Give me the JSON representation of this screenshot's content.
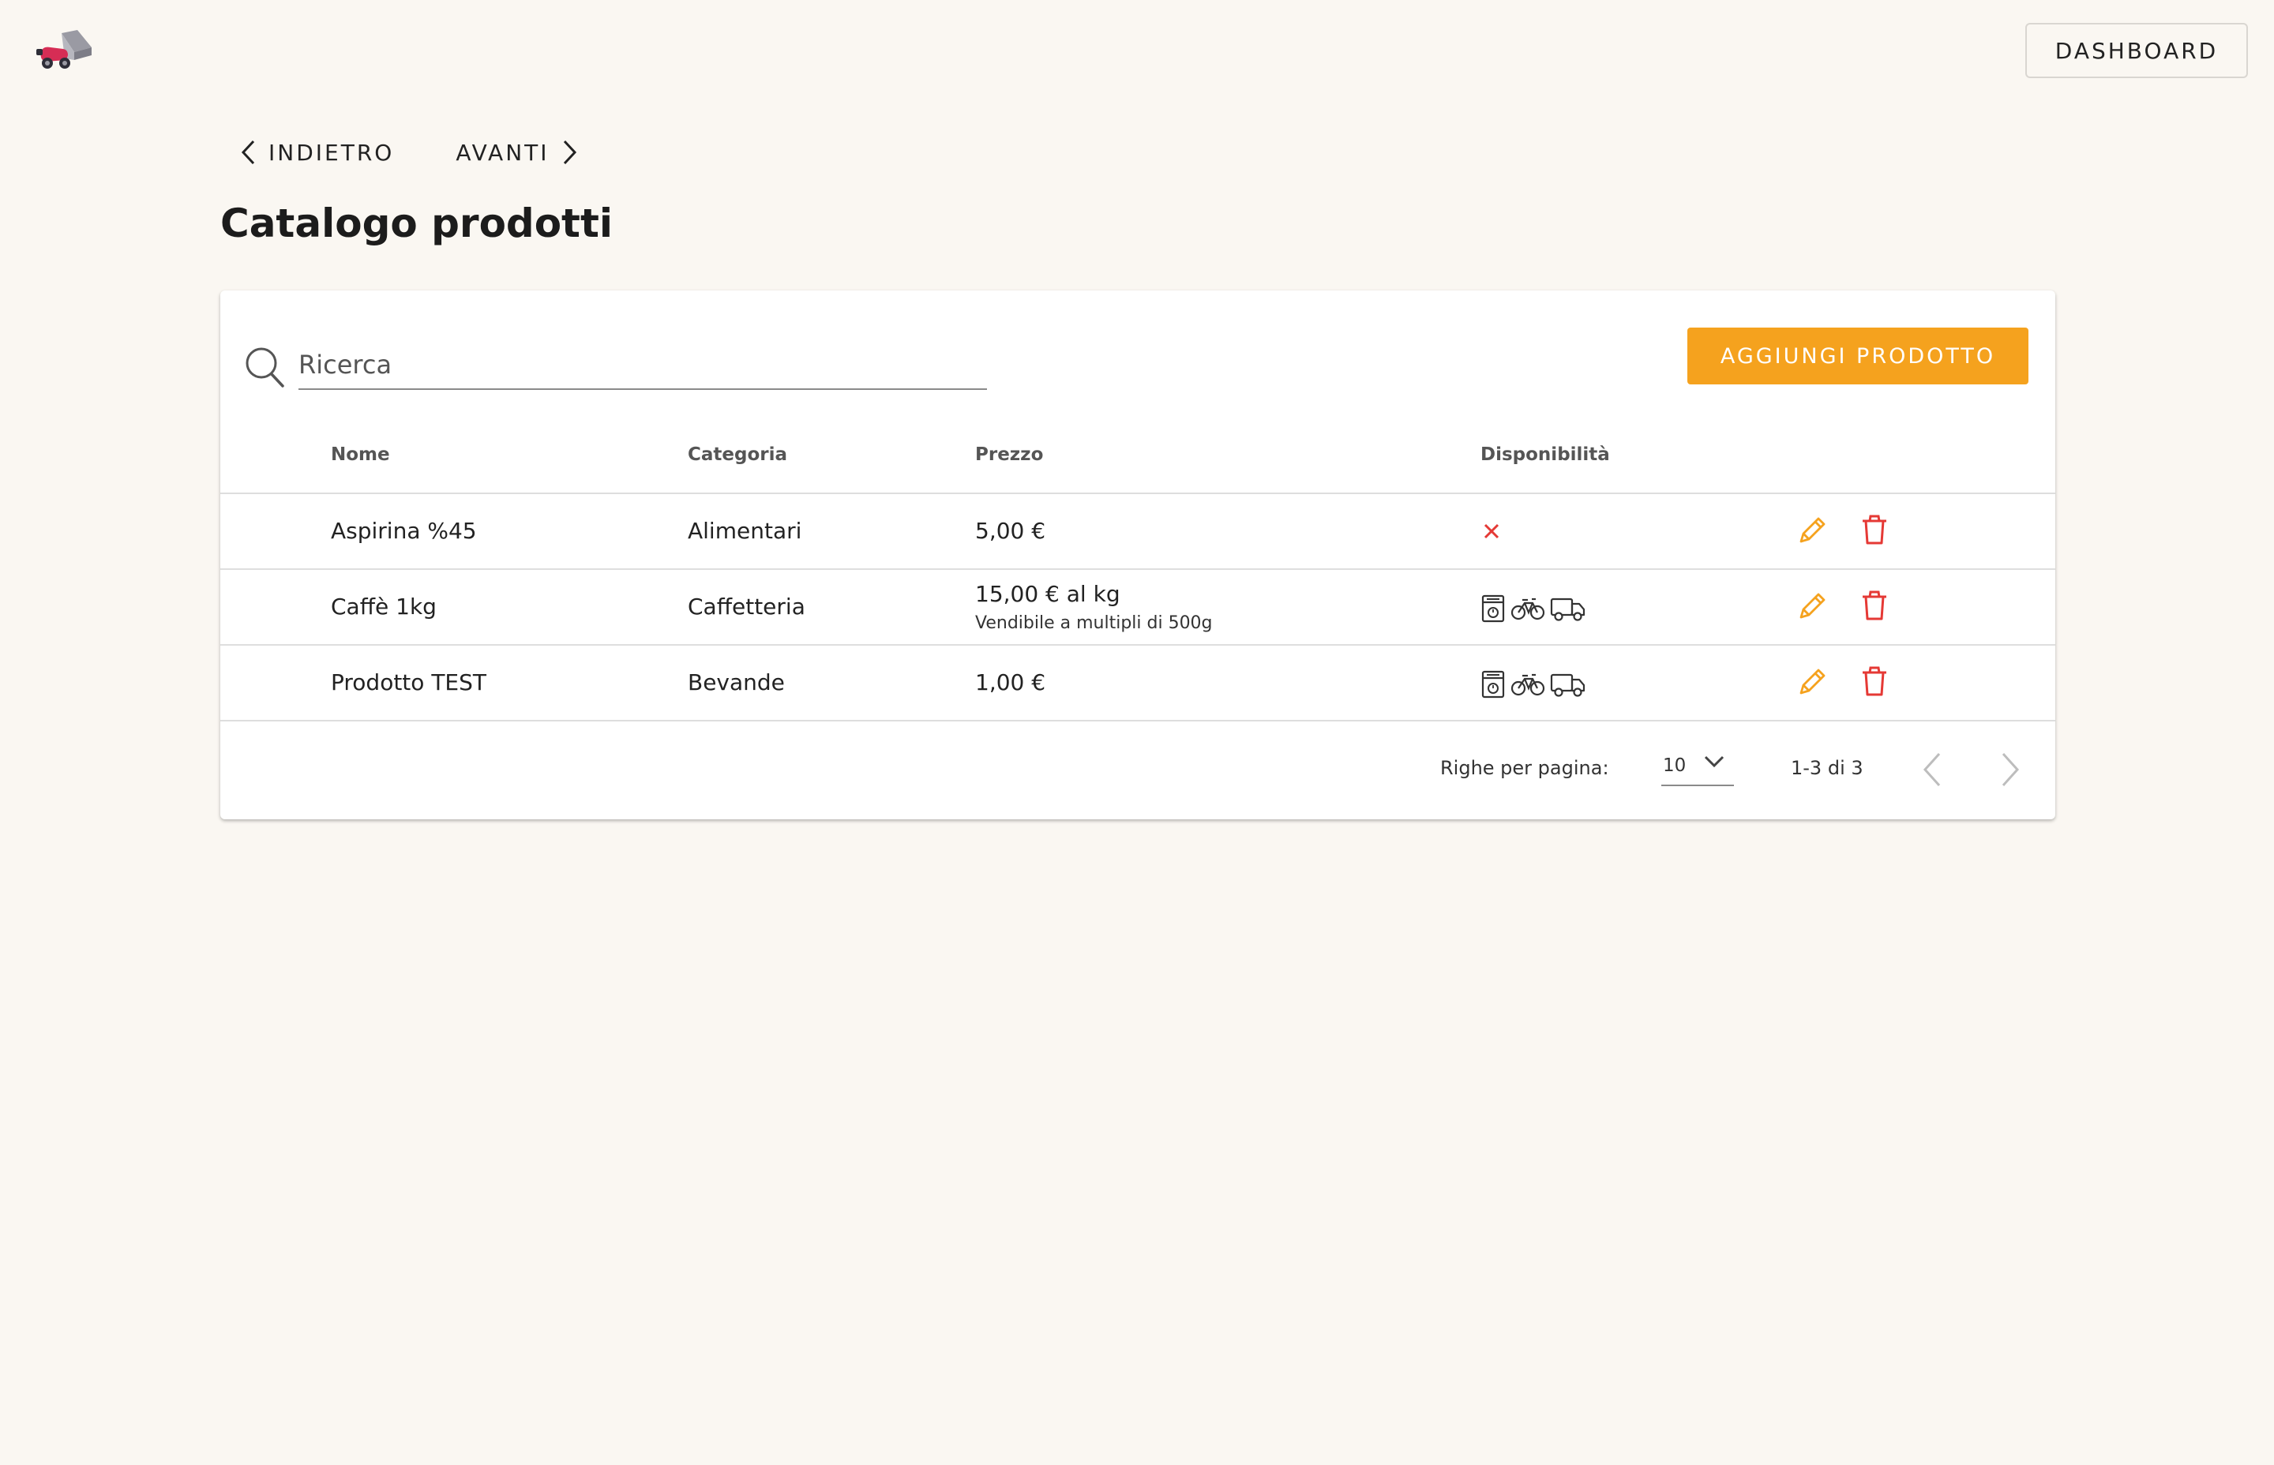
{
  "header": {
    "logo": "scooter-delivery-logo",
    "dashboard_label": "DASHBOARD"
  },
  "nav": {
    "back_label": "INDIETRO",
    "forward_label": "AVANTI"
  },
  "page": {
    "title": "Catalogo prodotti"
  },
  "toolbar": {
    "search_placeholder": "Ricerca",
    "search_value": "",
    "add_label": "AGGIUNGI PRODOTTO"
  },
  "table": {
    "columns": [
      "Nome",
      "Categoria",
      "Prezzo",
      "Disponibilità"
    ],
    "rows": [
      {
        "name": "Aspirina %45",
        "category": "Alimentari",
        "price": "5,00 €",
        "price_note": "",
        "availability": [
          "unavailable-x-icon"
        ]
      },
      {
        "name": "Caffè 1kg",
        "category": "Caffetteria",
        "price": "15,00 € al kg",
        "price_note": "Vendibile a multipli di 500g",
        "availability": [
          "store-icon",
          "bicycle-icon",
          "truck-icon"
        ]
      },
      {
        "name": "Prodotto TEST",
        "category": "Bevande",
        "price": "1,00 €",
        "price_note": "",
        "availability": [
          "store-icon",
          "bicycle-icon",
          "truck-icon"
        ]
      }
    ],
    "row_actions": [
      "pencil-icon",
      "trash-icon"
    ]
  },
  "pagination": {
    "rows_per_page_label": "Righe per pagina:",
    "rows_per_page_value": "10",
    "range": "1-3 di 3"
  },
  "colors": {
    "accent": "#f5a21e",
    "danger": "#e53935",
    "background": "#faf7f2"
  }
}
